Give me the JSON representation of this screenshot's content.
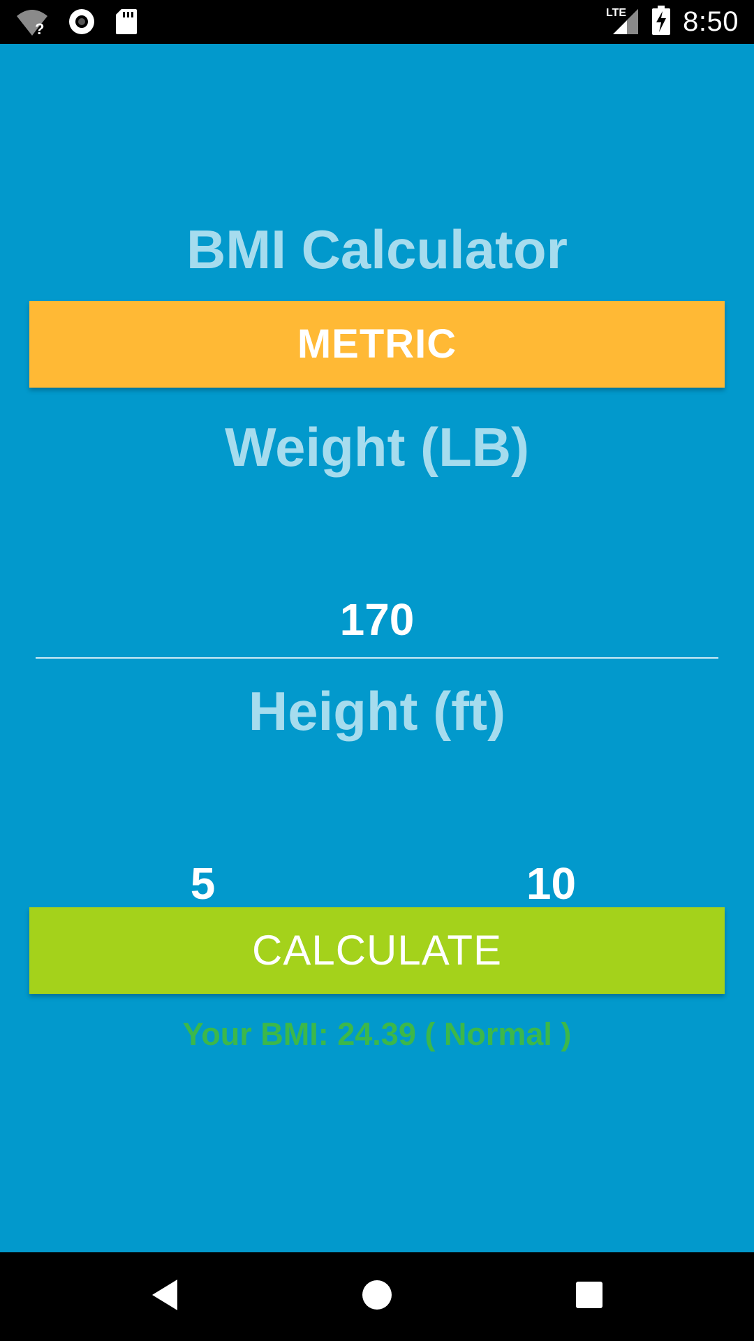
{
  "status_bar": {
    "time": "8:50",
    "network": "LTE",
    "icons": [
      "wifi-unknown-icon",
      "sync-icon",
      "sd-card-icon",
      "lte-signal-icon",
      "battery-charging-icon"
    ]
  },
  "app": {
    "title": "BMI Calculator",
    "unit_toggle_label": "METRIC",
    "weight_label": "Weight (LB)",
    "weight_value": "170",
    "height_label": "Height (ft)",
    "height_feet_value": "5",
    "height_inches_value": "10",
    "calculate_label": "CALCULATE",
    "result_text": "Your BMI: 24.39 ( Normal )"
  },
  "colors": {
    "background": "#0299CC",
    "metric_button": "#FFB935",
    "calculate_button": "#A4D21B",
    "label_text": "#A6DCEE",
    "result_text": "#3CB84A"
  },
  "nav_bar": {
    "buttons": [
      "back-icon",
      "home-icon",
      "recents-icon"
    ]
  }
}
